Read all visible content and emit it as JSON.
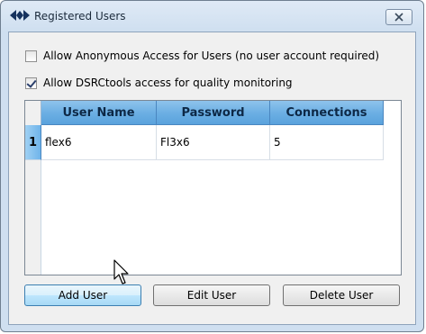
{
  "window": {
    "title": "Registered Users"
  },
  "options": [
    {
      "label": "Allow Anonymous Access for Users (no user account required)",
      "checked": false
    },
    {
      "label": "Allow DSRCtools access for quality monitoring",
      "checked": true
    }
  ],
  "grid": {
    "columns": [
      "User Name",
      "Password",
      "Connections"
    ],
    "rows": [
      {
        "index": "1",
        "user_name": "flex6",
        "password": "Fl3x6",
        "connections": "5"
      }
    ]
  },
  "buttons": {
    "add_user": "Add User",
    "edit_user": "Edit User",
    "delete_user": "Delete User"
  },
  "colors": {
    "header_blue": "#6aaee3",
    "window_frame": "#cfdff0"
  },
  "icons": {
    "app": "double-diamond-arrow-icon",
    "close": "close-icon",
    "cursor": "mouse-pointer-icon"
  }
}
